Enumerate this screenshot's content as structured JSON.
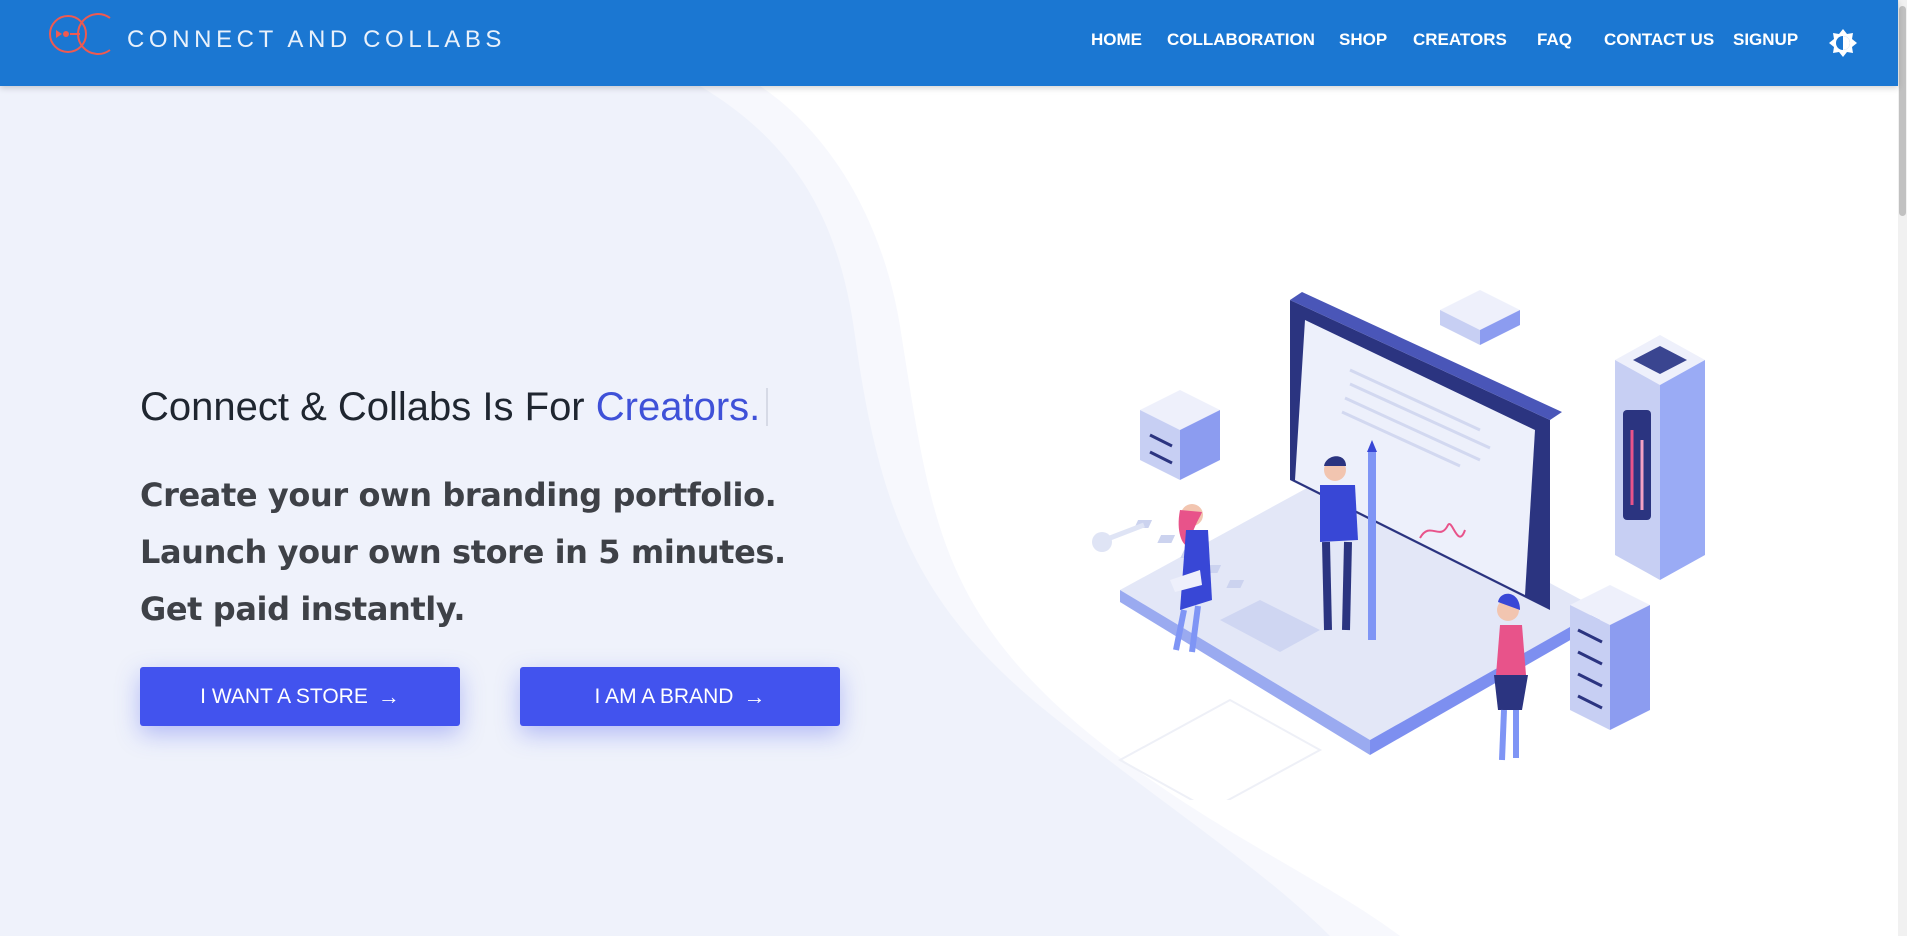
{
  "header": {
    "brand": "CONNECT AND COLLABS",
    "nav": [
      {
        "label": "HOME"
      },
      {
        "label": "COLLABORATION"
      },
      {
        "label": "SHOP"
      },
      {
        "label": "CREATORS"
      },
      {
        "label": "FAQ"
      },
      {
        "label": "CONTACT US"
      },
      {
        "label": "SIGNUP"
      }
    ],
    "theme_toggle_icon": "brightness-icon"
  },
  "hero": {
    "headline_prefix": "Connect & Collabs Is For",
    "headline_highlight": "Creators.",
    "taglines": [
      "Create your own branding portfolio.",
      "Launch your own store in 5 minutes.",
      "Get paid instantly."
    ],
    "buttons": [
      {
        "label": "I WANT A STORE",
        "icon": "arrow-right-icon"
      },
      {
        "label": "I AM A BRAND",
        "icon": "arrow-right-icon"
      }
    ]
  },
  "colors": {
    "navbar": "#1b77d2",
    "accent": "#3f51d8",
    "button": "#4253ee",
    "logo": "#ef5a50"
  }
}
